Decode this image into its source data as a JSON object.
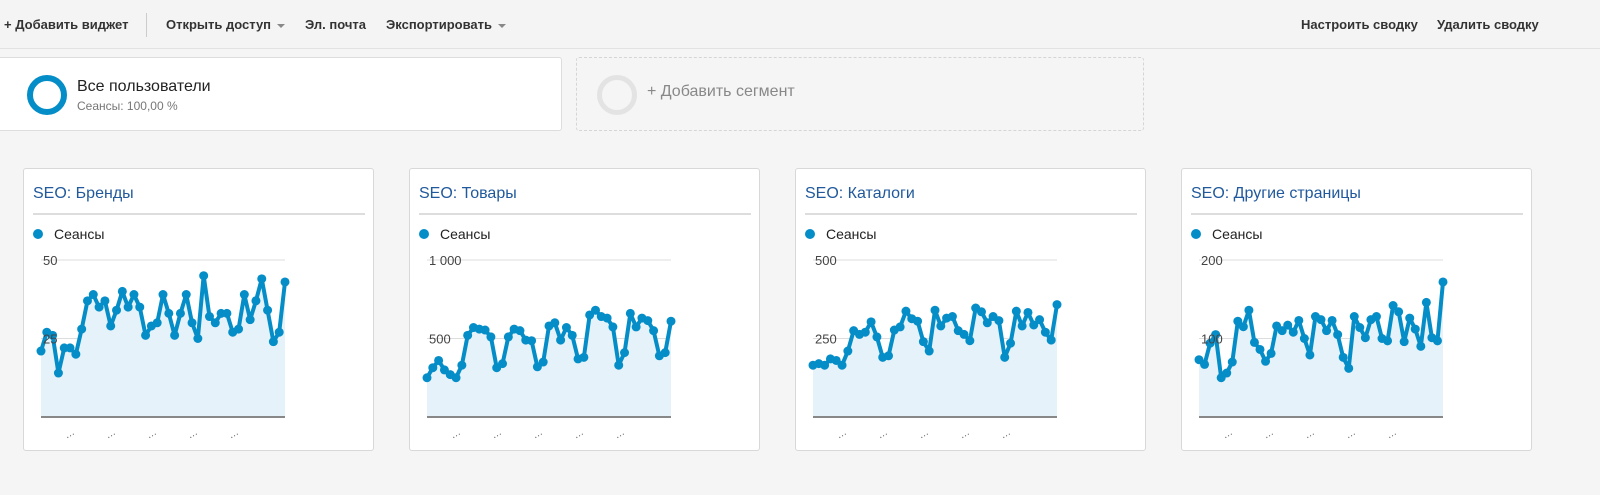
{
  "toolbar": {
    "add_widget": "+ Добавить виджет",
    "share": "Открыть доступ",
    "email": "Эл. почта",
    "export": "Экспортировать",
    "customize": "Настроить сводку",
    "delete": "Удалить сводку"
  },
  "segments": {
    "active": {
      "name": "Все пользователи",
      "sub": "Сеансы: 100,00 %"
    },
    "add": "+ Добавить сегмент"
  },
  "colors": {
    "series": "#058dc7",
    "area": "#e5f2f9",
    "title": "#20599c"
  },
  "widgets": [
    {
      "title": "SEO: Бренды",
      "legend": "Сеансы"
    },
    {
      "title": "SEO: Товары",
      "legend": "Сеансы"
    },
    {
      "title": "SEO: Каталоги",
      "legend": "Сеансы"
    },
    {
      "title": "SEO: Другие страницы",
      "legend": "Сеансы"
    }
  ],
  "chart_data": [
    {
      "type": "area",
      "series": [
        {
          "name": "Сеансы",
          "values": [
            21,
            27,
            26,
            14,
            22,
            22,
            20,
            28,
            37,
            39,
            35,
            37,
            29,
            34,
            40,
            35,
            39,
            35,
            26,
            29,
            30,
            39,
            33,
            26,
            33,
            39,
            30,
            25,
            45,
            32,
            30,
            33,
            33,
            27,
            28,
            39,
            31,
            37,
            44,
            34,
            24,
            27,
            43
          ]
        }
      ],
      "yticks": [
        "25",
        "50"
      ],
      "ytick_values": [
        25,
        50
      ],
      "ylim": [
        0,
        50
      ],
      "xticks": [
        "…",
        "…",
        "…",
        "…",
        "…"
      ]
    },
    {
      "type": "area",
      "series": [
        {
          "name": "Сеансы",
          "values": [
            250,
            314,
            360,
            300,
            270,
            250,
            330,
            520,
            570,
            560,
            554,
            510,
            314,
            340,
            510,
            560,
            550,
            490,
            486,
            320,
            350,
            580,
            600,
            490,
            570,
            520,
            370,
            380,
            650,
            680,
            640,
            630,
            574,
            330,
            410,
            660,
            574,
            630,
            614,
            550,
            390,
            410,
            610
          ]
        }
      ],
      "yticks": [
        "500",
        "1 000"
      ],
      "ytick_values": [
        500,
        1000
      ],
      "ylim": [
        0,
        1000
      ],
      "xticks": [
        "…",
        "…",
        "…",
        "…",
        "…"
      ]
    },
    {
      "type": "area",
      "series": [
        {
          "name": "Сеансы",
          "values": [
            165,
            170,
            165,
            185,
            180,
            165,
            210,
            275,
            263,
            270,
            303,
            255,
            190,
            195,
            277,
            287,
            337,
            313,
            305,
            240,
            210,
            340,
            290,
            315,
            320,
            275,
            263,
            243,
            347,
            335,
            300,
            320,
            307,
            190,
            235,
            337,
            290,
            333,
            293,
            310,
            270,
            245,
            358
          ]
        }
      ],
      "yticks": [
        "250",
        "500"
      ],
      "ytick_values": [
        250,
        500
      ],
      "ylim": [
        0,
        500
      ],
      "xticks": [
        "…",
        "…",
        "…",
        "…",
        "…"
      ]
    },
    {
      "type": "area",
      "series": [
        {
          "name": "Сеансы",
          "values": [
            73,
            67,
            94,
            105,
            50,
            56,
            70,
            122,
            115,
            136,
            95,
            86,
            71,
            81,
            116,
            110,
            117,
            108,
            123,
            100,
            79,
            128,
            124,
            110,
            123,
            105,
            76,
            62,
            128,
            114,
            101,
            124,
            128,
            100,
            97,
            142,
            134,
            96,
            126,
            112,
            90,
            146,
            101,
            97,
            172
          ]
        }
      ],
      "yticks": [
        "100",
        "200"
      ],
      "ytick_values": [
        100,
        200
      ],
      "ylim": [
        0,
        200
      ],
      "xticks": [
        "…",
        "…",
        "…",
        "…",
        "…"
      ]
    }
  ]
}
